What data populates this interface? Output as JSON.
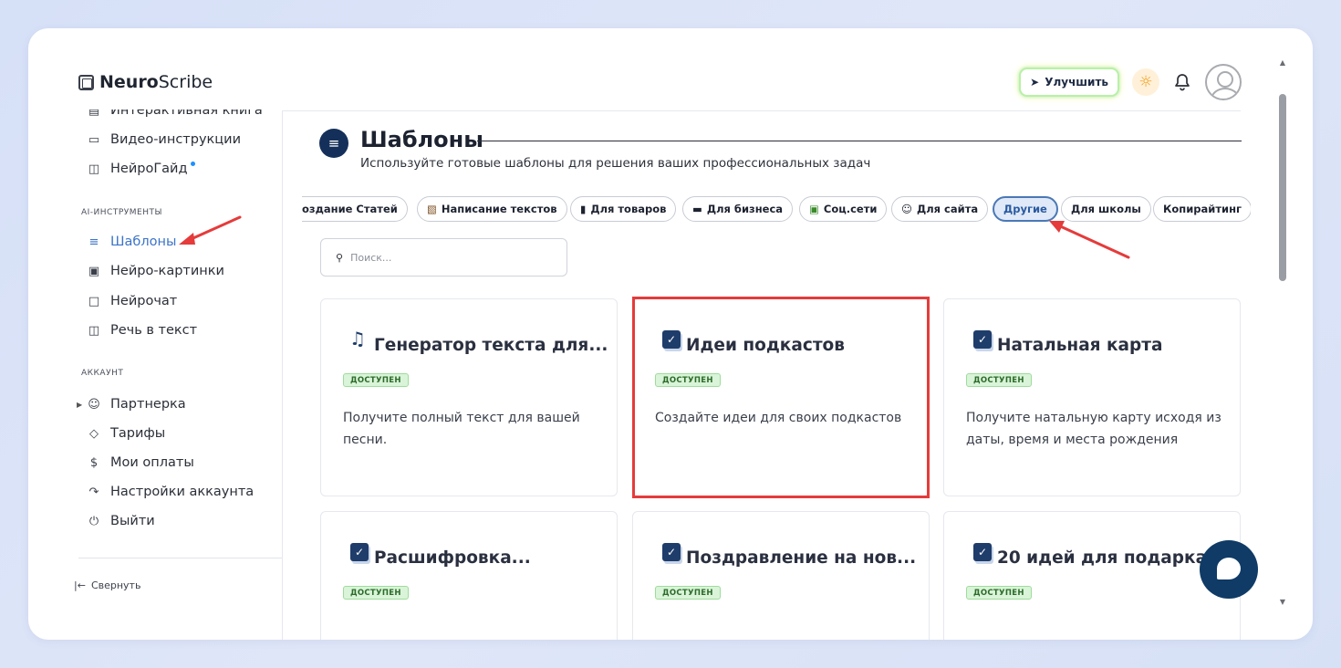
{
  "app": {
    "logo_bold": "Neuro",
    "logo_rest": "Scribe",
    "upgrade_label": "Улучшить"
  },
  "sidebar": {
    "top_items": [
      {
        "label": "Интерактивная книга",
        "icon": "book-icon"
      },
      {
        "label": "Видео-инструкции",
        "icon": "video-icon"
      },
      {
        "label": "НейроГайд",
        "icon": "guide-icon"
      }
    ],
    "section_ai": "AI-ИНСТРУМЕНТЫ",
    "ai_items": [
      {
        "label": "Шаблоны",
        "icon": "layers-icon",
        "active": true
      },
      {
        "label": "Нейро-картинки",
        "icon": "image-icon"
      },
      {
        "label": "Нейрочат",
        "icon": "chat-icon"
      },
      {
        "label": "Речь в текст",
        "icon": "headphones-icon"
      }
    ],
    "section_account": "АККАУНТ",
    "account_items": [
      {
        "label": "Партнерка",
        "icon": "users-icon"
      },
      {
        "label": "Тарифы",
        "icon": "tag-icon"
      },
      {
        "label": "Мои оплаты",
        "icon": "dollar-icon"
      },
      {
        "label": "Настройки аккаунта",
        "icon": "login-icon"
      },
      {
        "label": "Выйти",
        "icon": "power-icon"
      }
    ],
    "collapse_label": "Свернуть"
  },
  "main": {
    "title": "Шаблоны",
    "subtitle": "Используйте готовые шаблоны для решения ваших профессиональных задач",
    "tabs": [
      {
        "label": "оздание Статей"
      },
      {
        "label": "Написание текстов"
      },
      {
        "label": "Для товаров"
      },
      {
        "label": "Для бизнеса"
      },
      {
        "label": "Соц.сети"
      },
      {
        "label": "Для сайта"
      },
      {
        "label": "Другие",
        "active": true
      },
      {
        "label": "Для школы"
      },
      {
        "label": "Копирайтинг"
      }
    ],
    "search_placeholder": "Поиск...",
    "cards": [
      {
        "title": "Генератор текста для...",
        "badge": "ДОСТУПЕН",
        "desc": "Получите полный текст для вашей песни.",
        "icon": "music-icon"
      },
      {
        "title": "Идеи подкастов",
        "badge": "ДОСТУПЕН",
        "desc": "Создайте идеи для своих подкастов",
        "icon": "checkbox-icon"
      },
      {
        "title": "Натальная карта",
        "badge": "ДОСТУПЕН",
        "desc": "Получите натальную карту исходя из даты, время и места рождения",
        "icon": "checkbox-icon"
      },
      {
        "title": "Расшифровка...",
        "badge": "ДОСТУПЕН",
        "desc": "",
        "icon": "checkbox-icon"
      },
      {
        "title": "Поздравление на нов...",
        "badge": "ДОСТУПЕН",
        "desc": "",
        "icon": "checkbox-icon"
      },
      {
        "title": "20 идей для подарка",
        "badge": "ДОСТУПЕН",
        "desc": "",
        "icon": "checkbox-icon"
      }
    ]
  },
  "colors": {
    "accent": "#3c74c9",
    "annotation_red": "#e53b3b",
    "badge_green": "#d9f4d8",
    "navy": "#0f3b66"
  }
}
